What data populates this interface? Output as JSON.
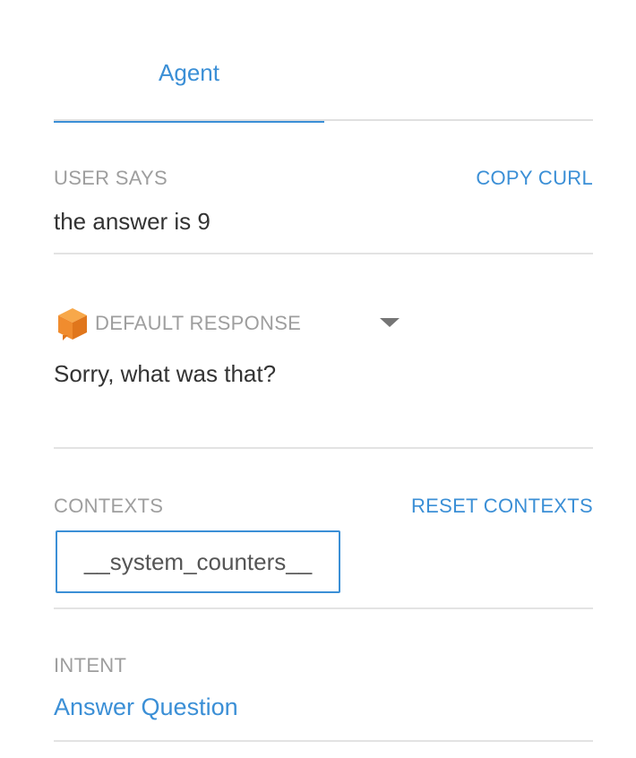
{
  "tabs": [
    {
      "label": "Agent",
      "active": true
    }
  ],
  "user_says": {
    "label": "USER SAYS",
    "action": "COPY CURL",
    "value": "the answer is 9"
  },
  "response": {
    "icon": "orange-cube-icon",
    "label": "DEFAULT RESPONSE",
    "text": "Sorry, what was that?"
  },
  "contexts": {
    "label": "CONTEXTS",
    "action": "RESET CONTEXTS",
    "items": [
      "__system_counters__"
    ]
  },
  "intent": {
    "label": "INTENT",
    "value": "Answer Question"
  },
  "colors": {
    "accent": "#3b8fd6",
    "label_gray": "#9e9e9e",
    "divider": "#e3e3e3",
    "cube_orange": "#f08c2e"
  }
}
